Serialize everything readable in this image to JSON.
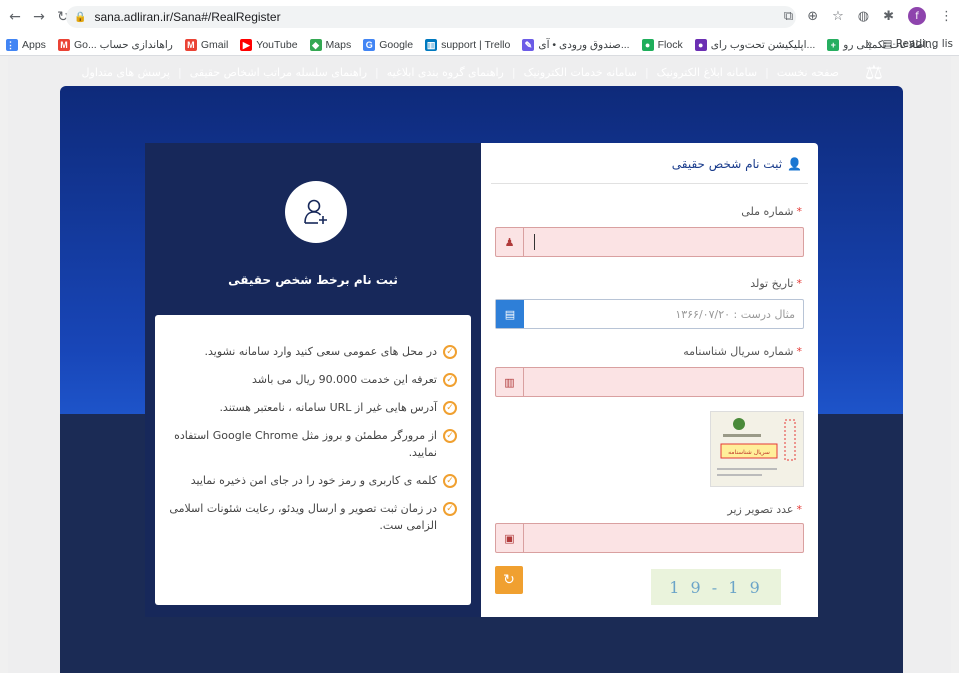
{
  "browser": {
    "url": "sana.adliran.ir/Sana#/RealRegister",
    "bookmarks": [
      {
        "label": "Apps",
        "color": "#4285f4",
        "glyph": "⋮⋮"
      },
      {
        "label": "Go... راهاندازی حساب",
        "color": "#ea4335",
        "glyph": "M"
      },
      {
        "label": "Gmail",
        "color": "#ea4335",
        "glyph": "M"
      },
      {
        "label": "YouTube",
        "color": "#ff0000",
        "glyph": "▶"
      },
      {
        "label": "Maps",
        "color": "#34a853",
        "glyph": "◆"
      },
      {
        "label": "Google",
        "color": "#4285f4",
        "glyph": "G"
      },
      {
        "label": "support | Trello",
        "color": "#0079bf",
        "glyph": "▥"
      },
      {
        "label": "صندوق ورودی • آی...",
        "color": "#6c5ce7",
        "glyph": "✎"
      },
      {
        "label": "Flock",
        "color": "#1fae5b",
        "glyph": "●"
      },
      {
        "label": "اپلیکیشن تحت‌وب رای...",
        "color": "#6b2fb3",
        "glyph": "●"
      },
      {
        "label": "اطلاعات تکمیلی رو...",
        "color": "#27ae60",
        "glyph": "+"
      }
    ],
    "overflow": "»",
    "reading_list": "Reading lis",
    "profile_initial": "f"
  },
  "nav": {
    "items": [
      "صفحه نخست",
      "سامانه ابلاغ الکترونیک",
      "سامانه خدمات الکترونیک",
      "راهنمای گروه بندی ابلاغیه",
      "راهنمای سلسله مراتب اشخاص حقیقی",
      "پرسش های متداول"
    ],
    "separator": "|"
  },
  "left": {
    "title": "ثبت نام برخط شخص حقیقی",
    "rules": [
      "در محل های عمومی سعی کنید وارد سامانه نشوید.",
      "تعرفه این خدمت 90.000 ریال می باشد",
      "آدرس هایی غیر از URL سامانه ، نامعتبر هستند.",
      "از مرورگر مطمئن و بروز مثل Google Chrome استفاده نمایید.",
      "کلمه ی کاربری و رمز خود را در جای امن ذخیره نمایید",
      "در زمان ثبت تصویر و ارسال ویدئو، رعایت شئونات اسلامی الزامی ست."
    ]
  },
  "form": {
    "title": "ثبت نام شخص حقیقی",
    "national_id_label": "شماره ملی",
    "birth_date_label": "تاریخ تولد",
    "birth_date_placeholder": "مثال درست : ۱۳۶۶/۰۷/۲۰",
    "serial_label": "شماره سریال شناسنامه",
    "captcha_label": "عدد تصویر زیر",
    "captcha_text": "9 1 - 9 1",
    "required_mark": "*",
    "sample_card_text": "سریال شناسنامه"
  }
}
